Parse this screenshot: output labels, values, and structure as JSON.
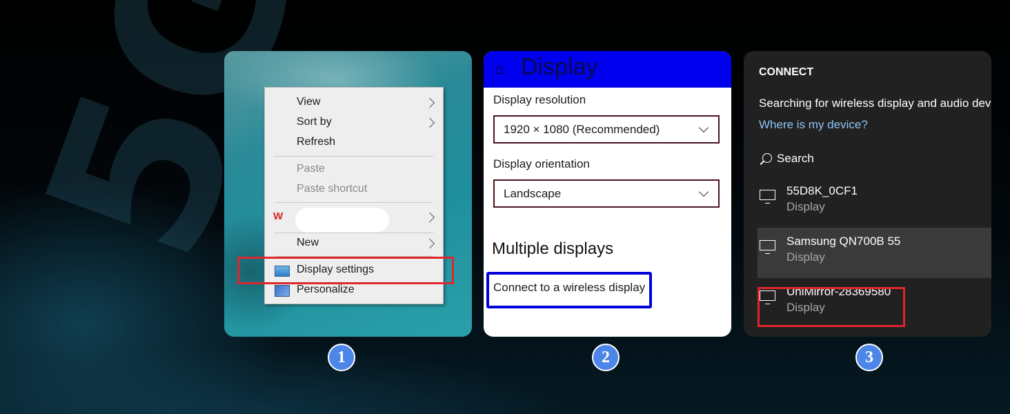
{
  "panel1": {
    "menu": {
      "view": "View",
      "sort_by": "Sort by",
      "refresh": "Refresh",
      "paste": "Paste",
      "paste_shortcut": "Paste shortcut",
      "new": "New",
      "display_settings": "Display settings",
      "personalize": "Personalize"
    },
    "wps_logo_text": "W",
    "highlight_color": "#e0262b"
  },
  "panel2": {
    "title": "Display",
    "resolution_label": "Display resolution",
    "resolution_value": "1920 × 1080 (Recommended)",
    "orientation_label": "Display orientation",
    "orientation_value": "Landscape",
    "multiple_heading": "Multiple displays",
    "wireless_link": "Connect to a wireless display",
    "header_color": "#0000ee"
  },
  "panel3": {
    "title": "CONNECT",
    "status": "Searching for wireless display and audio devices",
    "help_link": "Where is my device?",
    "search_label": "Search",
    "devices": [
      {
        "name": "55D8K_0CF1",
        "type": "Display"
      },
      {
        "name": "Samsung QN700B 55",
        "type": "Display"
      },
      {
        "name": "UniMirror-28369580",
        "type": "Display"
      }
    ]
  },
  "steps": [
    "1",
    "2",
    "3"
  ],
  "icons": {
    "home": "home-icon",
    "search": "search-icon",
    "monitor": "monitor-icon",
    "display_settings": "display-settings-icon",
    "personalize": "personalize-icon"
  }
}
